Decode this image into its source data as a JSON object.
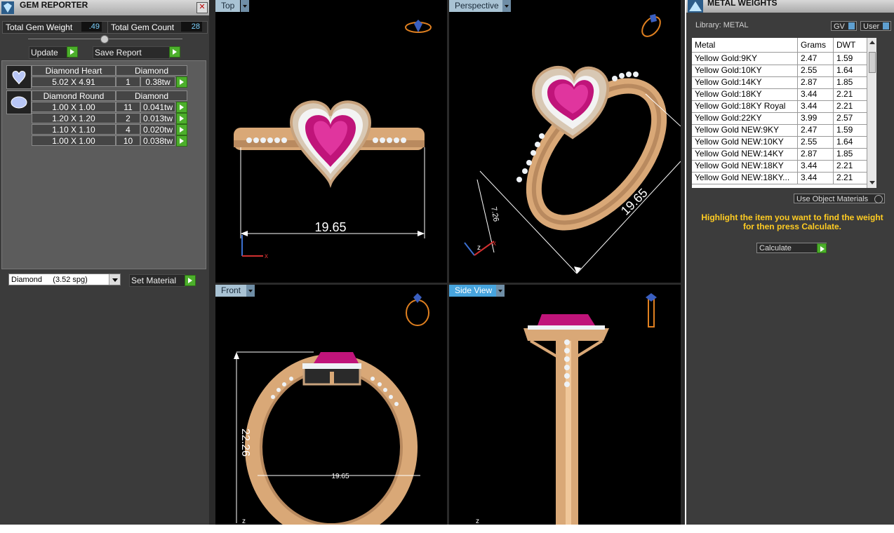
{
  "gem_reporter": {
    "title": "GEM REPORTER",
    "close": "✕",
    "total_weight_label": "Total Gem Weight",
    "total_weight_value": ".49",
    "total_count_label": "Total Gem Count",
    "total_count_value": "28",
    "update_label": "Update",
    "save_report_label": "Save Report",
    "groups": [
      {
        "shape": "Diamond Heart",
        "material": "Diamond",
        "rows": [
          {
            "size": "5.02 X 4.91",
            "count": "1",
            "weight": "0.38tw"
          }
        ]
      },
      {
        "shape": "Diamond Round",
        "material": "Diamond",
        "rows": [
          {
            "size": "1.00 X 1.00",
            "count": "11",
            "weight": "0.041tw"
          },
          {
            "size": "1.20 X 1.20",
            "count": "2",
            "weight": "0.013tw"
          },
          {
            "size": "1.10 X 1.10",
            "count": "4",
            "weight": "0.020tw"
          },
          {
            "size": "1.00 X 1.00",
            "count": "10",
            "weight": "0.038tw"
          }
        ]
      }
    ],
    "material_select": "Diamond     (3.52 spg)",
    "set_material_label": "Set Material"
  },
  "viewports": {
    "top": {
      "label": "Top",
      "dimension": "19.65",
      "axis_x": "x"
    },
    "perspective": {
      "label": "Perspective",
      "dimension_long": "19.65",
      "dimension_short": "7.26",
      "axis_x": "x",
      "axis_z": "z"
    },
    "front": {
      "label": "Front",
      "dimension": "22.26",
      "dimension_hidden": "19.65",
      "axis_z": "z"
    },
    "side": {
      "label": "Side View",
      "axis_z": "z"
    }
  },
  "metal_weights": {
    "title": "METAL WEIGHTS",
    "library": "Library: METAL",
    "gv_label": "GV",
    "user_label": "User",
    "columns": [
      "Metal",
      "Grams",
      "DWT"
    ],
    "rows": [
      {
        "metal": "Yellow Gold:9KY",
        "grams": "2.47",
        "dwt": "1.59"
      },
      {
        "metal": "Yellow Gold:10KY",
        "grams": "2.55",
        "dwt": "1.64"
      },
      {
        "metal": "Yellow Gold:14KY",
        "grams": "2.87",
        "dwt": "1.85"
      },
      {
        "metal": "Yellow Gold:18KY",
        "grams": "3.44",
        "dwt": "2.21"
      },
      {
        "metal": "Yellow Gold:18KY Royal",
        "grams": "3.44",
        "dwt": "2.21"
      },
      {
        "metal": "Yellow Gold:22KY",
        "grams": "3.99",
        "dwt": "2.57"
      },
      {
        "metal": "Yellow Gold NEW:9KY",
        "grams": "2.47",
        "dwt": "1.59"
      },
      {
        "metal": "Yellow Gold NEW:10KY",
        "grams": "2.55",
        "dwt": "1.64"
      },
      {
        "metal": "Yellow Gold NEW:14KY",
        "grams": "2.87",
        "dwt": "1.85"
      },
      {
        "metal": "Yellow Gold NEW:18KY",
        "grams": "3.44",
        "dwt": "2.21"
      },
      {
        "metal": "Yellow Gold NEW:18KY...",
        "grams": "3.44",
        "dwt": "2.21"
      }
    ],
    "use_object_materials": "Use Object Materials",
    "instruction": "Highlight the item you want to find the weight for then press Calculate.",
    "calculate_label": "Calculate"
  },
  "colors": {
    "gold": "#d9a877",
    "gem": "#c0147a",
    "viewport_label": "#a9c3d4",
    "accent_green": "#4caf2b",
    "instruction_text": "#ffcc22"
  }
}
